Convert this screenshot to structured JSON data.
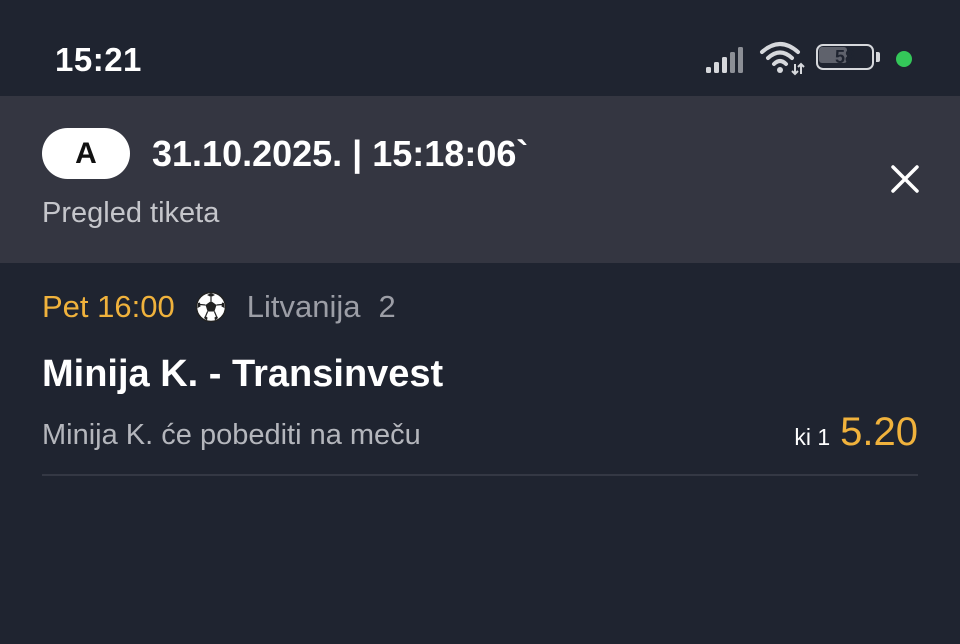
{
  "status_bar": {
    "time": "15:21",
    "battery_level": "58",
    "battery_fraction": 0.58,
    "dot_color": "#34c759",
    "icons": [
      "signal-icon",
      "wifi-icon",
      "battery-icon"
    ]
  },
  "header": {
    "ticket_type": "A",
    "datetime": "31.10.2025. | 15:18:06`",
    "subtitle": "Pregled tiketa",
    "close_icon": "close-icon"
  },
  "bet": {
    "time": "Pet 16:00",
    "sport_icon": "soccer-ball-icon",
    "league": "Litvanija",
    "round": "2",
    "match": "Minija K. - Transinvest",
    "selection": "Minija K. će pobediti na meču",
    "odds_label": "ki 1",
    "odds_value": "5.20"
  },
  "colors": {
    "background": "#1f2430",
    "header_background": "#343641",
    "accent": "#f0b23c",
    "status_dot": "#34c759"
  }
}
